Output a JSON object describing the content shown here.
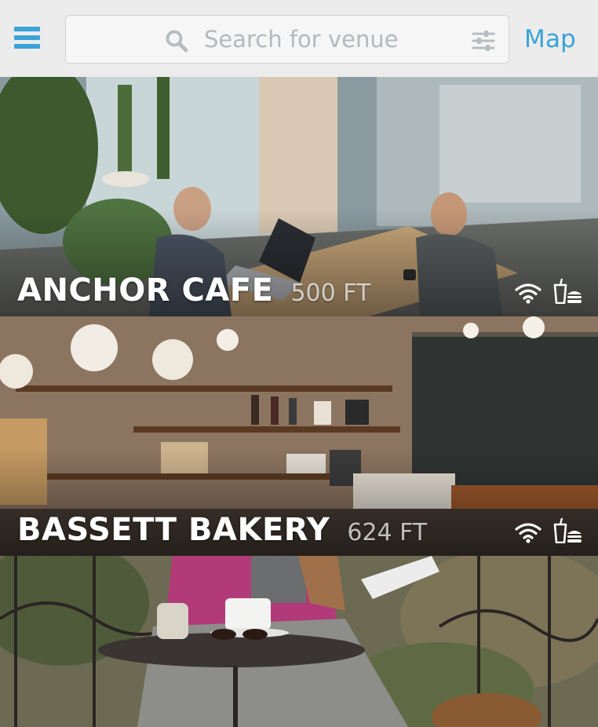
{
  "header": {
    "search_placeholder": "Search for venue",
    "map_label": "Map"
  },
  "icons": {
    "menu": "hamburger-menu-icon",
    "search": "search-icon",
    "filter": "sliders-filter-icon",
    "wifi": "wifi-icon",
    "food": "drink-and-burger-icon"
  },
  "colors": {
    "accent": "#3aa3d8",
    "header_bg": "#fafafa",
    "caption_text": "#ffffff"
  },
  "venues": [
    {
      "name": "ANCHOR CAFE",
      "distance": "500 FT",
      "amenities": [
        "wifi",
        "food"
      ]
    },
    {
      "name": "BASSETT BAKERY",
      "distance": "624 FT",
      "amenities": [
        "wifi",
        "food"
      ]
    },
    {
      "name": "",
      "distance": "",
      "amenities": []
    }
  ]
}
